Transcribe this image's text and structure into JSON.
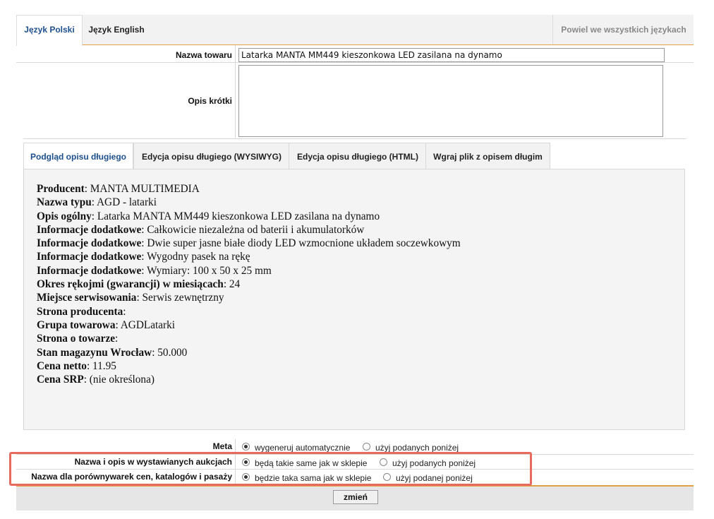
{
  "lang_tabs": {
    "polish": "Język Polski",
    "english": "Język English",
    "copy_all": "Powiel we wszystkich językach"
  },
  "form": {
    "product_name_label": "Nazwa towaru",
    "product_name_value": "Latarka MANTA MM449 kieszonkowa LED zasilana na dynamo",
    "short_desc_label": "Opis krótki",
    "short_desc_value": ""
  },
  "desc_tabs": [
    "Podgląd opisu długiego",
    "Edycja opisu długiego (WYSIWYG)",
    "Edycja opisu długiego (HTML)",
    "Wgraj plik z opisem długim"
  ],
  "preview_rows": [
    {
      "key": "Producent",
      "value": "MANTA MULTIMEDIA"
    },
    {
      "key": "Nazwa typu",
      "value": "AGD - latarki"
    },
    {
      "key": "Opis ogólny",
      "value": "Latarka MANTA MM449 kieszonkowa LED zasilana na dynamo"
    },
    {
      "key": "Informacje dodatkowe",
      "value": "Całkowicie niezależna od baterii i akumulatorków"
    },
    {
      "key": "Informacje dodatkowe",
      "value": "Dwie super jasne białe diody LED wzmocnione układem soczewkowym"
    },
    {
      "key": "Informacje dodatkowe",
      "value": "Wygodny pasek na rękę"
    },
    {
      "key": "Informacje dodatkowe",
      "value": "Wymiary: 100 x 50 x 25 mm"
    },
    {
      "key": "Okres rękojmi (gwarancji) w miesiącach",
      "value": "24"
    },
    {
      "key": "Miejsce serwisowania",
      "value": "Serwis zewnętrzny"
    },
    {
      "key": "Strona producenta",
      "value": ""
    },
    {
      "key": "Grupa towarowa",
      "value": "AGDLatarki"
    },
    {
      "key": "Strona o towarze",
      "value": ""
    },
    {
      "key": "Stan magazynu Wrocław",
      "value": "50.000"
    },
    {
      "key": "Cena netto",
      "value": "11.95"
    },
    {
      "key": "Cena SRP",
      "value": "(nie określona)"
    }
  ],
  "meta": {
    "label": "Meta",
    "opt_auto": "wygeneruj automatycznie",
    "opt_custom": "użyj podanych poniżej"
  },
  "auctions": {
    "label": "Nazwa i opis w wystawianych aukcjach",
    "opt_same": "będą takie same jak w sklepie",
    "opt_custom": "użyj podanych poniżej"
  },
  "comparators": {
    "label": "Nazwa dla porównywarek cen, katalogów i pasaży",
    "opt_same": "będzie taka sama jak w sklepie",
    "opt_custom": "użyj podanej poniżej"
  },
  "submit_label": "zmień",
  "colors": {
    "accent_orange": "#e2a040",
    "active_tab_text": "#1d4f8f",
    "highlight_box": "#e96a5c"
  }
}
